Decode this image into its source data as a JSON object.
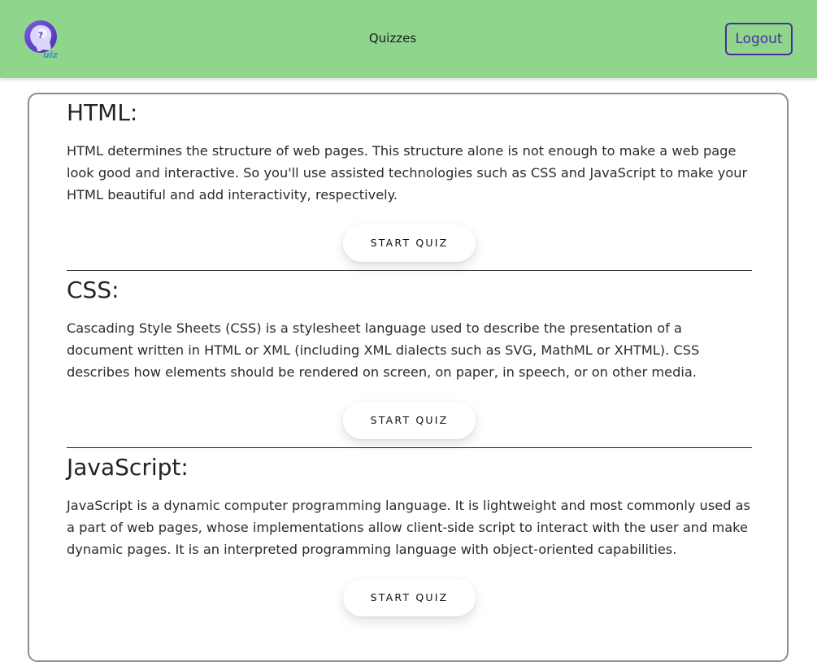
{
  "header": {
    "title": "Quizzes",
    "logout_label": "Logout",
    "logo_text": "uiz",
    "logo_mark": "?",
    "bg_color": "#8fd68c",
    "accent_color": "#4b2ca3"
  },
  "topics": [
    {
      "title": "HTML:",
      "description": "HTML determines the structure of web pages. This structure alone is not enough to make a web page look good and interactive. So you'll use assisted technologies such as CSS and JavaScript to make your HTML beautiful and add interactivity, respectively.",
      "button_label": "START QUIZ"
    },
    {
      "title": "CSS:",
      "description": "Cascading Style Sheets (CSS) is a stylesheet language used to describe the presentation of a document written in HTML or XML (including XML dialects such as SVG, MathML or XHTML). CSS describes how elements should be rendered on screen, on paper, in speech, or on other media.",
      "button_label": "START QUIZ"
    },
    {
      "title": "JavaScript:",
      "description": "JavaScript is a dynamic computer programming language. It is lightweight and most commonly used as a part of web pages, whose implementations allow client-side script to interact with the user and make dynamic pages. It is an interpreted programming language with object-oriented capabilities.",
      "button_label": "START QUIZ"
    }
  ]
}
